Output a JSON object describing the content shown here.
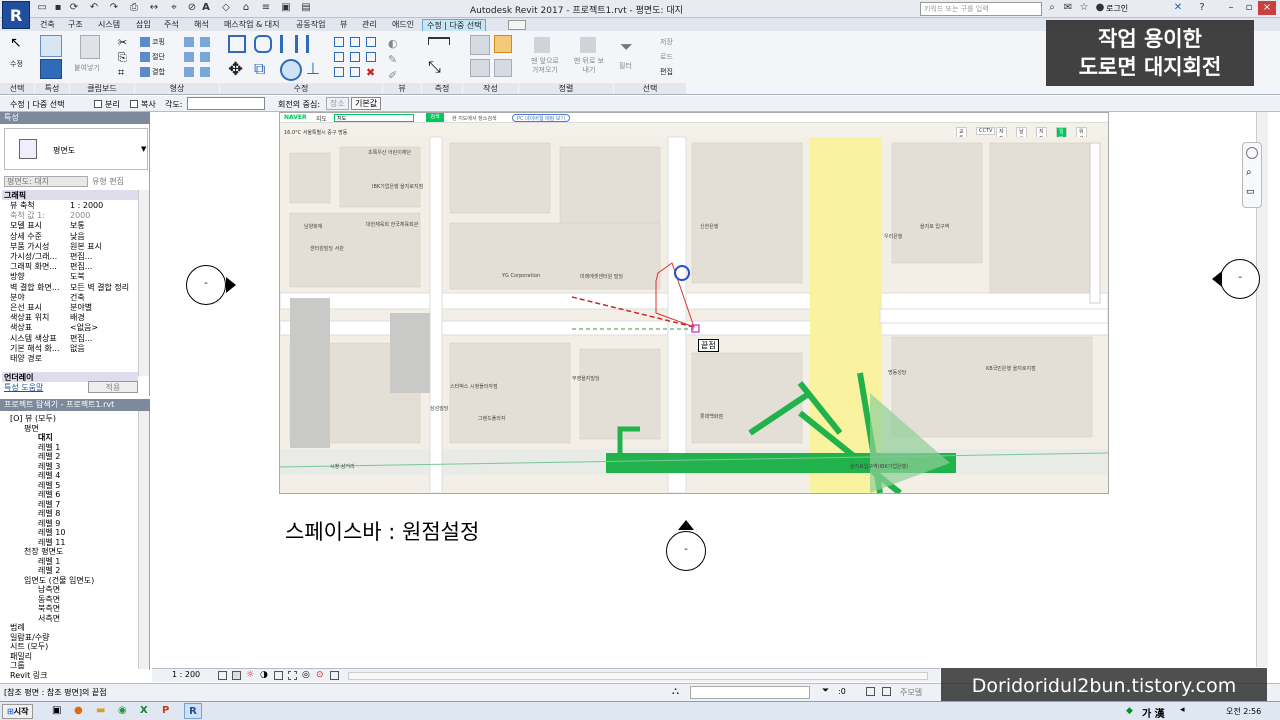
{
  "app": {
    "logo": "R",
    "title": "Autodesk Revit 2017 -   프로젝트1.rvt - 평면도: 대지",
    "search_placeholder": "키워드 또는 구를 입력",
    "login": "로그인"
  },
  "tabs": [
    "건축",
    "구조",
    "시스템",
    "삽입",
    "주석",
    "해석",
    "매스작업 & 대지",
    "공동작업",
    "뷰",
    "관리",
    "애드인",
    "수정 | 다중 선택"
  ],
  "ribbon": {
    "select_label": "수정",
    "panels": [
      "선택",
      "특성",
      "클립보드",
      "형상",
      "수정",
      "뷰",
      "측정",
      "작성",
      "정렬",
      "선택"
    ],
    "paste_label": "붙여넣기",
    "geom_items": [
      "코핑",
      "절단",
      "결합"
    ],
    "host_items": [
      "맨 앞으로 가져오기",
      "맨 뒤로 보내기"
    ],
    "filter_label": "필터",
    "select_items": [
      "저장",
      "로드",
      "편집"
    ]
  },
  "options_bar": {
    "context": "수정 | 다중 선택",
    "split": "분리",
    "copy": "복사",
    "angle_label": "각도:",
    "center_label": "회전의 중심:",
    "place_btn": "장소",
    "default_btn": "기본값"
  },
  "properties": {
    "header": "특성",
    "type_name": "평면도",
    "view_selector": "평면도: 대지",
    "edit_type": "유형 편집",
    "section": "그래픽",
    "rows": [
      {
        "k": "뷰 축척",
        "v": "1 : 2000",
        "gray": false
      },
      {
        "k": "축척 값 1:",
        "v": "2000",
        "gray": true
      },
      {
        "k": "모델 표시",
        "v": "보통",
        "gray": false
      },
      {
        "k": "상세 수준",
        "v": "낮음",
        "gray": false
      },
      {
        "k": "부품 가시성",
        "v": "원본 표시",
        "gray": false
      },
      {
        "k": "가시성/그래...",
        "v": "편집...",
        "gray": false
      },
      {
        "k": "그래픽 화면...",
        "v": "편집...",
        "gray": false
      },
      {
        "k": "방향",
        "v": "도북",
        "gray": false
      },
      {
        "k": "벽 결합 화면...",
        "v": "모든 벽 결합 정리",
        "gray": false
      },
      {
        "k": "분야",
        "v": "건축",
        "gray": false
      },
      {
        "k": "은선 표시",
        "v": "분야별",
        "gray": false
      },
      {
        "k": "색상표 위치",
        "v": "배경",
        "gray": false
      },
      {
        "k": "색상표",
        "v": "<없음>",
        "gray": false
      },
      {
        "k": "시스템 색상표",
        "v": "편집...",
        "gray": false
      },
      {
        "k": "기본 해석 화...",
        "v": "없음",
        "gray": false
      },
      {
        "k": "태양 경로",
        "v": "",
        "gray": false
      }
    ],
    "underlay": "언더레이",
    "help_link": "특성 도움말",
    "apply": "적용"
  },
  "browser": {
    "header": "프로젝트 탐색기 - 프로젝트1.rvt",
    "nodes": [
      {
        "t": "[O] 뷰 (모두)",
        "l": 0
      },
      {
        "t": "평면",
        "l": 1
      },
      {
        "t": "대지",
        "l": 2,
        "bold": true
      },
      {
        "t": "레벨 1",
        "l": 2
      },
      {
        "t": "레벨 2",
        "l": 2
      },
      {
        "t": "레벨 3",
        "l": 2
      },
      {
        "t": "레벨 4",
        "l": 2
      },
      {
        "t": "레벨 5",
        "l": 2
      },
      {
        "t": "레벨 6",
        "l": 2
      },
      {
        "t": "레벨 7",
        "l": 2
      },
      {
        "t": "레벨 8",
        "l": 2
      },
      {
        "t": "레벨 9",
        "l": 2
      },
      {
        "t": "레벨 10",
        "l": 2
      },
      {
        "t": "레벨 11",
        "l": 2
      },
      {
        "t": "천장 평면도",
        "l": 1
      },
      {
        "t": "레벨 1",
        "l": 2
      },
      {
        "t": "레벨 2",
        "l": 2
      },
      {
        "t": "입면도 (건물 입면도)",
        "l": 1
      },
      {
        "t": "남측면",
        "l": 2
      },
      {
        "t": "동측면",
        "l": 2
      },
      {
        "t": "북측면",
        "l": 2
      },
      {
        "t": "서측면",
        "l": 2
      },
      {
        "t": "범례",
        "l": 0
      },
      {
        "t": "일람표/수량",
        "l": 0
      },
      {
        "t": "시트 (모두)",
        "l": 0
      },
      {
        "t": "패밀리",
        "l": 0
      },
      {
        "t": "그룹",
        "l": 0
      },
      {
        "t": "Revit 링크",
        "l": 0
      }
    ]
  },
  "map": {
    "brand": "NAVER",
    "brand_suffix": "지도",
    "search_value": "지도",
    "search_btn": "검색",
    "checkbox_label": "현 지도에서 장소검색",
    "banner": "PC 네이버웹 매핑 보기",
    "temperature": "16.0°C",
    "location": "서울특별시 중구 명동",
    "top_tabs": [
      "교통정보",
      "CCTV",
      "자전거",
      "날씨",
      "지적편집도",
      "일반",
      "위성"
    ],
    "labels": [
      "초록우산 어린이재단",
      "IBK기업은행 을지로지점",
      "대한체육회 한국체육회관",
      "남양화재",
      "센터원빌딩 서관",
      "YG Corporation",
      "미래에셋센터원 빌딩",
      "신한은행",
      "우리은행",
      "을지로 입구역",
      "KB국민은행 을지로지점",
      "명동성당",
      "을지로입구역(IBK기업은행)",
      "롯데백화점",
      "시청 삼거리",
      "그랜드플라자",
      "부영을지빌딩",
      "삼성빌딩",
      "스타벅스 시청플라자점"
    ],
    "endpoint_label": "끝점"
  },
  "caption": "스페이스바 : 원점설정",
  "overlay_title": [
    "작업 용이한",
    "도로면 대지회전"
  ],
  "watermark": "Doridoridul2bun.tistory.com",
  "view_scale": "1 : 200",
  "status": {
    "text": "[참조 평면 : 참조 평면]의 끝점",
    "zoom": ":0",
    "mode": "주모델"
  },
  "taskbar": {
    "start": "시작",
    "ime": "가 漢",
    "clock": "오전 2:56"
  },
  "elevation_marks": [
    "-",
    "-",
    "-"
  ],
  "colors": {
    "accent": "#1f4f9e",
    "ribbon_tab_active": "#c6e6f6",
    "map_road": "#ffffff",
    "metro_line": "#22b24c",
    "highlight": "#f9f3a0"
  }
}
